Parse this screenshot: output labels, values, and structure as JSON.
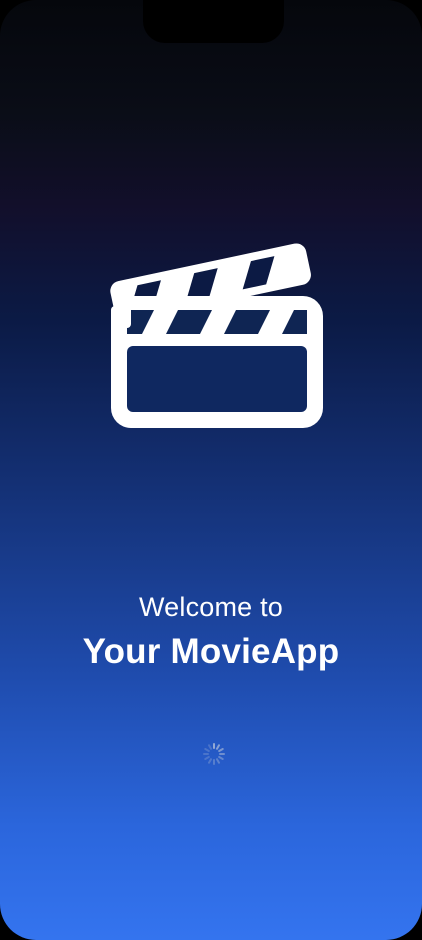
{
  "splash": {
    "welcome_text": "Welcome to",
    "app_name": "Your MovieApp",
    "logo_icon": "clapperboard-icon",
    "loading_icon": "activity-spinner-icon"
  },
  "colors": {
    "gradient_top": "#05070c",
    "gradient_bottom": "#3474ef",
    "text": "#ffffff"
  }
}
